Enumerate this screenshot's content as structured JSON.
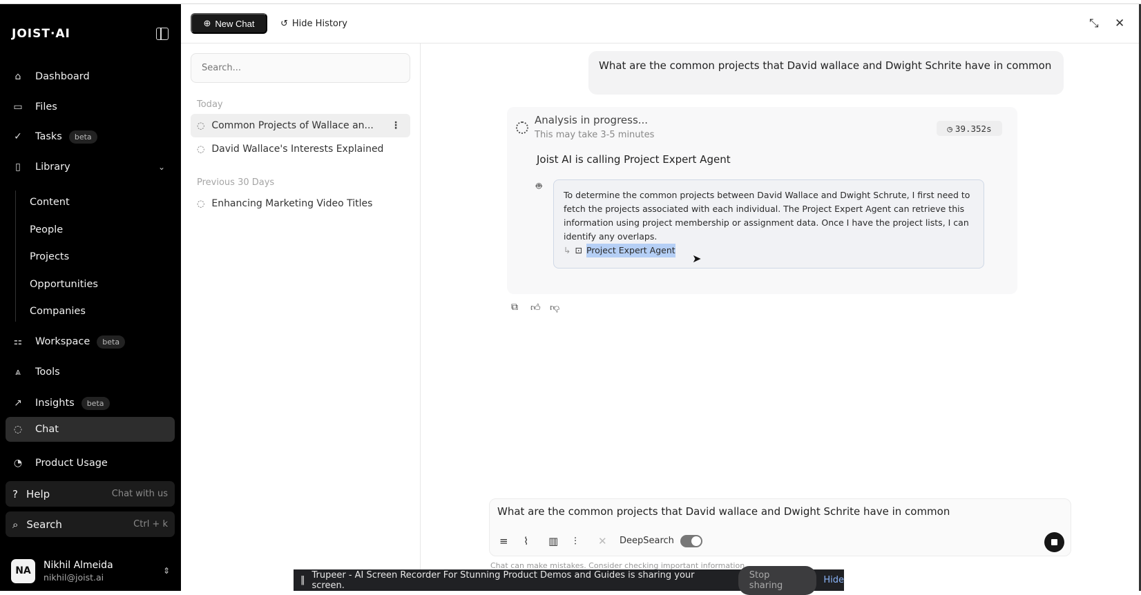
{
  "sidebar": {
    "logo": "JOIST·AI",
    "items": [
      {
        "label": "Dashboard",
        "icon": "⌂"
      },
      {
        "label": "Files",
        "icon": "▭"
      },
      {
        "label": "Tasks",
        "icon": "✓",
        "badge": "beta"
      },
      {
        "label": "Library",
        "icon": "▯"
      },
      {
        "label": "Content"
      },
      {
        "label": "People"
      },
      {
        "label": "Projects"
      },
      {
        "label": "Opportunities"
      },
      {
        "label": "Companies"
      },
      {
        "label": "Workspace",
        "icon": "⚏",
        "badge": "beta"
      },
      {
        "label": "Tools",
        "icon": "⩓"
      },
      {
        "label": "Insights",
        "icon": "↗",
        "badge": "beta"
      },
      {
        "label": "Chat",
        "icon": "◌"
      },
      {
        "label": "Product Usage",
        "icon": "◔"
      }
    ],
    "help": {
      "label": "Help",
      "hint": "Chat with us"
    },
    "search": {
      "label": "Search",
      "hint": "Ctrl + k"
    },
    "user": {
      "initials": "NA",
      "name": "Nikhil Almeida",
      "email": "nikhil@joist.ai"
    }
  },
  "header": {
    "new_chat": "New Chat",
    "hide_history": "Hide History"
  },
  "history": {
    "search_placeholder": "Search...",
    "groups": [
      {
        "label": "Today",
        "items": [
          "Common Projects of Wallace an...",
          "David Wallace's Interests Explained"
        ]
      },
      {
        "label": "Previous 30 Days",
        "items": [
          "Enhancing Marketing Video Titles"
        ]
      }
    ]
  },
  "chat": {
    "user_message": "What are the common projects that David wallace and Dwight Schrite have in common",
    "status_title": "Analysis in progress...",
    "status_sub": "This may take 3-5 minutes",
    "timer": "39.352s",
    "calling": "Joist AI is calling Project Expert Agent",
    "reasoning": "To determine the common projects between David Wallace and Dwight Schrute, I first need to fetch the projects associated with each individual. The Project Expert Agent can retrieve this information using project membership or assignment data. Once I have the project lists, I can identify any overlaps.",
    "agent": "Project Expert Agent"
  },
  "composer": {
    "value": "What are the common projects that David wallace and Dwight Schrite have in common",
    "deepsearch": "DeepSearch",
    "deepsearch_on": true,
    "disclaimer": "Chat can make mistakes. Consider checking important information."
  },
  "share_bar": {
    "message": "Trupeer - AI Screen Recorder For Stunning Product Demos and Guides is sharing your screen.",
    "stop": "Stop sharing",
    "hide": "Hide"
  }
}
